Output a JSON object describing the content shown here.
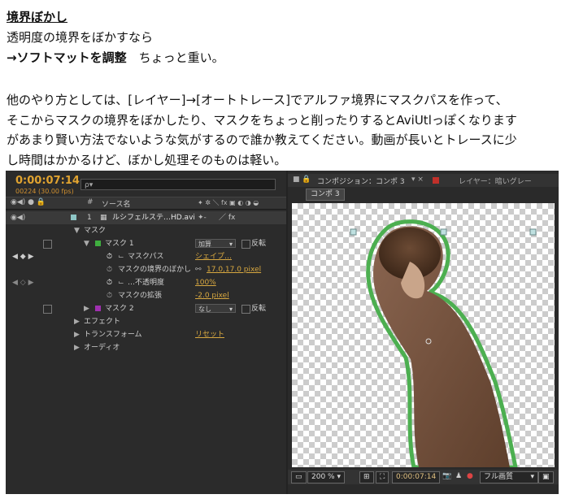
{
  "article": {
    "title": "境界ぼかし",
    "line1": "透明度の境界をぼかすなら",
    "line2_bold": "→ソフトマットを調整",
    "line2_rest": "　ちょっと重い。",
    "para": [
      "他のやり方としては、[レイヤー]→[オートトレース]でアルファ境界にマスクパスを作って、",
      "そこからマスクの境界をぼかしたり、マスクをちょっと削ったりするとAviUtlっぽくなります",
      "があまり賢い方法でないような気がするので誰か教えてください。動画が長いとトレースに少",
      "し時間はかかるけど、ぼかし処理そのものは軽い。"
    ]
  },
  "timeline": {
    "timecode": "0:00:07:14",
    "timecode_sub": "00224 (30.00 fps)",
    "search_placeholder": "ρ▾",
    "header_hash": "#",
    "header_source": "ソース名",
    "header_switches": "✦ ✲ ＼ fx ▣ ◐ ◑ ◒",
    "layer_number": "1",
    "layer_name": "ルシフェルステ…HD.avi",
    "layer_fx_switch": "／ fx",
    "mask_group": "マスク",
    "mask1": "マスク 1",
    "mask1_mode": "加算",
    "invert_label": "反転",
    "mask_path": "マスクパス",
    "mask_path_value": "シェイプ…",
    "mask_feather": "マスクの境界のぼかし",
    "mask_feather_value": "17.0,17.0 pixel",
    "mask_opacity": "…不透明度",
    "mask_opacity_value": "100%",
    "mask_expansion": "マスクの拡張",
    "mask_expansion_value": "-2.0 pixel",
    "mask2": "マスク 2",
    "mask2_mode": "なし",
    "effects": "エフェクト",
    "transform": "トランスフォーム",
    "transform_reset": "リセット",
    "audio": "オーディオ"
  },
  "composition": {
    "tab_label": "コンポジション：コンポ 3",
    "layer_tab_label": "レイヤー：暗いグレー",
    "comp_name": "コンポ 3",
    "zoom": "200 %",
    "timecode": "0:00:07:14",
    "quality": "フル画質"
  },
  "colors": {
    "timecode": "#e0a330",
    "mask1_swatch": "#3fae3f",
    "mask2_swatch": "#a030b0",
    "mask_outline": "#4caf50",
    "layer_swatch": "#8ec6c6"
  }
}
